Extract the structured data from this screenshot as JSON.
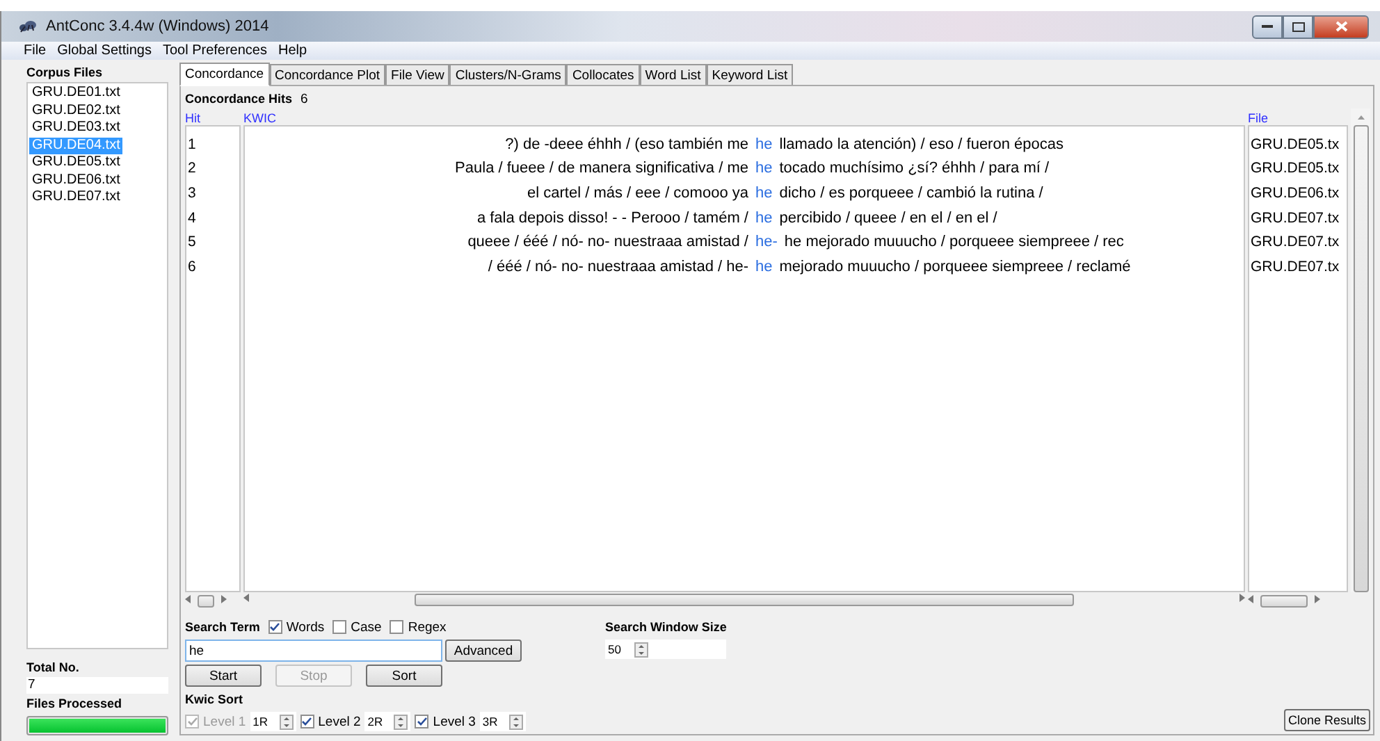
{
  "window": {
    "title": "AntConc 3.4.4w (Windows) 2014"
  },
  "menu": [
    "File",
    "Global Settings",
    "Tool Preferences",
    "Help"
  ],
  "sidebar": {
    "title": "Corpus Files",
    "files": [
      {
        "name": "GRU.DE01.txt",
        "selected": false
      },
      {
        "name": "GRU.DE02.txt",
        "selected": false
      },
      {
        "name": "GRU.DE03.txt",
        "selected": false
      },
      {
        "name": "GRU.DE04.txt",
        "selected": true
      },
      {
        "name": "GRU.DE05.txt",
        "selected": false
      },
      {
        "name": "GRU.DE06.txt",
        "selected": false
      },
      {
        "name": "GRU.DE07.txt",
        "selected": false
      }
    ],
    "total_label": "Total No.",
    "total": "7",
    "processed_label": "Files Processed",
    "progress": {
      "level": 1
    }
  },
  "tabs": [
    {
      "label": "Concordance",
      "selected": true
    },
    {
      "label": "Concordance Plot",
      "selected": false
    },
    {
      "label": "File View",
      "selected": false
    },
    {
      "label": "Clusters/N-Grams",
      "selected": false
    },
    {
      "label": "Collocates",
      "selected": false
    },
    {
      "label": "Word List",
      "selected": false
    },
    {
      "label": "Keyword List",
      "selected": false
    }
  ],
  "hits": {
    "label": "Concordance Hits",
    "count": "6"
  },
  "table": {
    "columns": [
      "Hit",
      "KWIC",
      "File"
    ],
    "rows": [
      {
        "hit": "1",
        "left": "?) de -deee éhhh /  (eso también me",
        "key": "he",
        "right": "llamado  la atención) /  eso / fueron épocas",
        "file": "GRU.DE05.tx"
      },
      {
        "hit": "2",
        "left": "Paula / fueee / de manera significativa / me",
        "key": "he",
        "right": "tocado muchísimo ¿sí? éhhh / para mí /",
        "file": "GRU.DE05.tx"
      },
      {
        "hit": "3",
        "left": "el cartel / más  / eee / comooo ya",
        "key": "he",
        "right": "dicho / es porqueee / cambió la rutina /",
        "file": "GRU.DE06.tx"
      },
      {
        "hit": "4",
        "left": "a fala depois disso!  -  - Perooo / tamém  /",
        "key": "he",
        "right": "percibido / queee / en el / en el /",
        "file": "GRU.DE07.tx"
      },
      {
        "hit": "5",
        "left": "queee / ééé / nó- no- nuestraaa amistad /",
        "key": "he-",
        "right": "he mejorado muuucho / porqueee siempreee / rec",
        "file": "GRU.DE07.tx"
      },
      {
        "hit": "6",
        "left": "/ ééé / nó- no- nuestraaa amistad / he-",
        "key": "he",
        "right": "mejorado muuucho / porqueee siempreee / reclamé",
        "file": "GRU.DE07.tx"
      }
    ]
  },
  "search": {
    "label": "Search Term",
    "options": [
      {
        "label": "Words",
        "checked": true
      },
      {
        "label": "Case",
        "checked": false
      },
      {
        "label": "Regex",
        "checked": false
      }
    ],
    "value": "he",
    "advanced": "Advanced",
    "window_label": "Search Window Size",
    "window_size": "50"
  },
  "buttons": [
    {
      "label": "Start",
      "disabled": false
    },
    {
      "label": "Stop",
      "disabled": true
    },
    {
      "label": "Sort",
      "disabled": false
    }
  ],
  "kwic_sort": {
    "label": "Kwic Sort",
    "levels": [
      {
        "label": "Level 1",
        "value": "1R",
        "checked": true,
        "disabled": true
      },
      {
        "label": "Level 2",
        "value": "2R",
        "checked": true,
        "disabled": false
      },
      {
        "label": "Level 3",
        "value": "3R",
        "checked": true,
        "disabled": false
      }
    ]
  },
  "clone": "Clone Results"
}
